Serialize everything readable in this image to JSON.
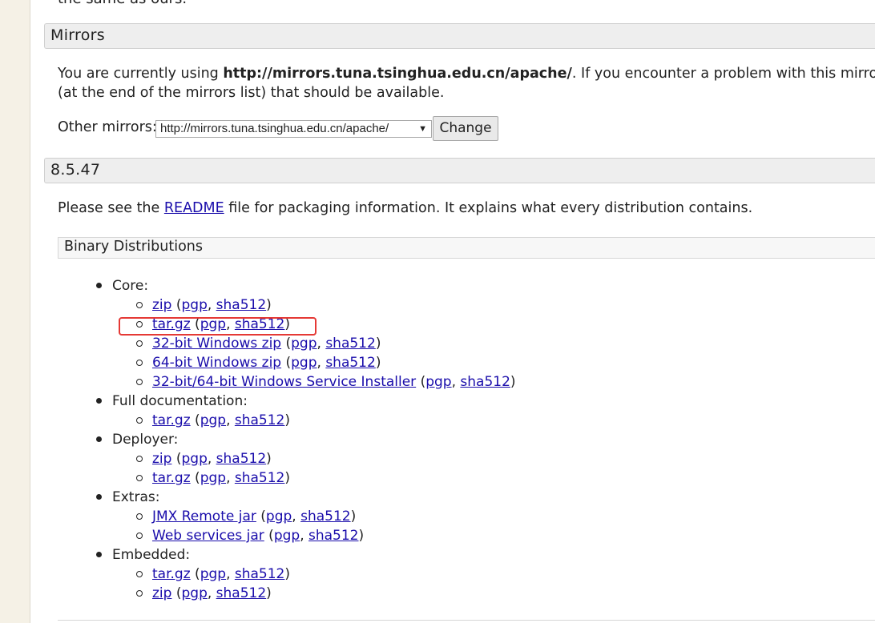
{
  "page": {
    "cut_text": "the same as ours."
  },
  "mirrors": {
    "header": "Mirrors",
    "line1_prefix": "You are currently using ",
    "line1_url": "http://mirrors.tuna.tsinghua.edu.cn/apache/",
    "line1_suffix": ". If you encounter a problem with this mirror, please s",
    "line2": "(at the end of the mirrors list) that should be available.",
    "other_label": "Other mirrors: ",
    "selected_mirror": "http://mirrors.tuna.tsinghua.edu.cn/apache/",
    "change_label": "Change"
  },
  "version": {
    "header": "8.5.47",
    "readme_prefix": "Please see the ",
    "readme_link": "README",
    "readme_suffix": " file for packaging information. It explains what every distribution contains."
  },
  "binary": {
    "header": "Binary Distributions",
    "groups": [
      {
        "label": "Core:",
        "items": [
          {
            "name": "zip",
            "pgp": "pgp",
            "sha": "sha512"
          },
          {
            "name": "tar.gz",
            "pgp": "pgp",
            "sha": "sha512"
          },
          {
            "name": "32-bit Windows zip",
            "pgp": "pgp",
            "sha": "sha512"
          },
          {
            "name": "64-bit Windows zip",
            "pgp": "pgp",
            "sha": "sha512"
          },
          {
            "name": "32-bit/64-bit Windows Service Installer",
            "pgp": "pgp",
            "sha": "sha512"
          }
        ]
      },
      {
        "label": "Full documentation:",
        "items": [
          {
            "name": "tar.gz",
            "pgp": "pgp",
            "sha": "sha512"
          }
        ]
      },
      {
        "label": "Deployer:",
        "items": [
          {
            "name": "zip",
            "pgp": "pgp",
            "sha": "sha512"
          },
          {
            "name": "tar.gz",
            "pgp": "pgp",
            "sha": "sha512"
          }
        ]
      },
      {
        "label": "Extras:",
        "items": [
          {
            "name": "JMX Remote jar",
            "pgp": "pgp",
            "sha": "sha512"
          },
          {
            "name": "Web services jar",
            "pgp": "pgp",
            "sha": "sha512"
          }
        ]
      },
      {
        "label": "Embedded:",
        "items": [
          {
            "name": "tar.gz",
            "pgp": "pgp",
            "sha": "sha512"
          },
          {
            "name": "zip",
            "pgp": "pgp",
            "sha": "sha512"
          }
        ]
      }
    ]
  },
  "colors": {
    "link": "#1a0dab",
    "highlight": "#e53935"
  },
  "punct": {
    "open": " (",
    "comma": ", ",
    "close": ")"
  }
}
